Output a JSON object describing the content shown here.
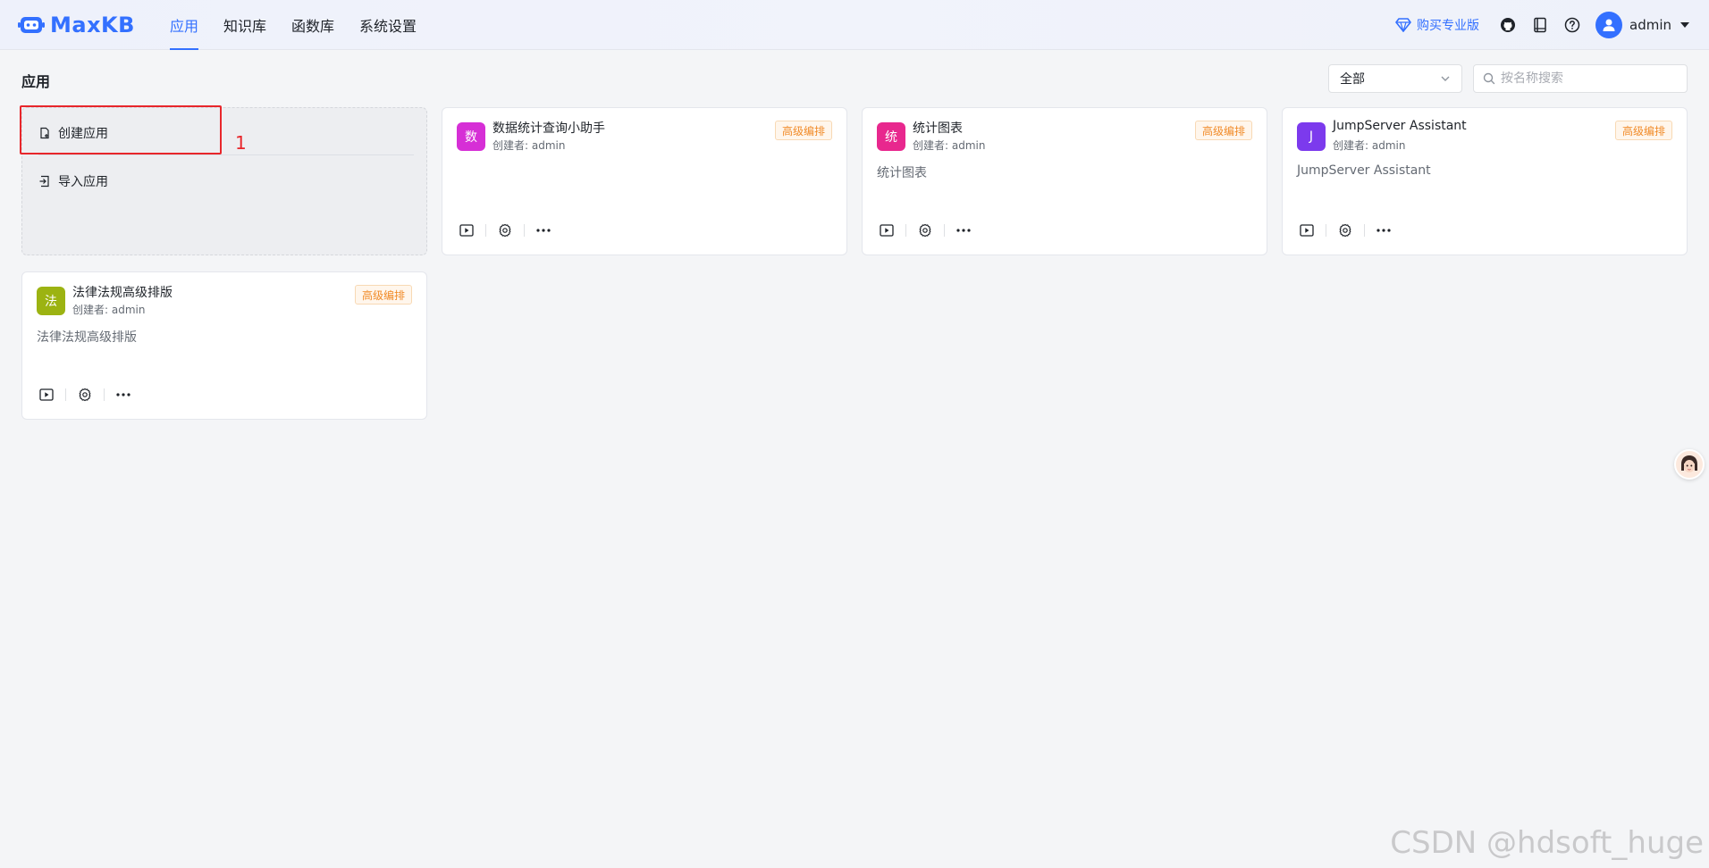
{
  "header": {
    "logo_text": "MaxKB",
    "nav": [
      {
        "label": "应用",
        "active": true
      },
      {
        "label": "知识库",
        "active": false
      },
      {
        "label": "函数库",
        "active": false
      },
      {
        "label": "系统设置",
        "active": false
      }
    ],
    "upgrade_label": "购买专业版",
    "user_name": "admin"
  },
  "page": {
    "title": "应用",
    "filter_value": "全部",
    "search_placeholder": "按名称搜索"
  },
  "create_card": {
    "create_label": "创建应用",
    "import_label": "导入应用",
    "annotation": "1"
  },
  "apps": [
    {
      "icon_text": "数",
      "icon_color": "#d62fd6",
      "name": "数据统计查询小助手",
      "creator": "创建者: admin",
      "tag": "高级编排",
      "desc": ""
    },
    {
      "icon_text": "统",
      "icon_color": "#e8288e",
      "name": "统计图表",
      "creator": "创建者: admin",
      "tag": "高级编排",
      "desc": "统计图表"
    },
    {
      "icon_text": "J",
      "icon_color": "#7c3aed",
      "name": "JumpServer Assistant",
      "creator": "创建者: admin",
      "tag": "高级编排",
      "desc": "JumpServer Assistant"
    },
    {
      "icon_text": "法",
      "icon_color": "#9cb312",
      "name": "法律法规高级排版",
      "creator": "创建者: admin",
      "tag": "高级编排",
      "desc": "法律法规高级排版"
    }
  ],
  "watermark": "CSDN @hdsoft_huge",
  "colors": {
    "accent": "#3370ff",
    "highlight": "#e8262b"
  }
}
